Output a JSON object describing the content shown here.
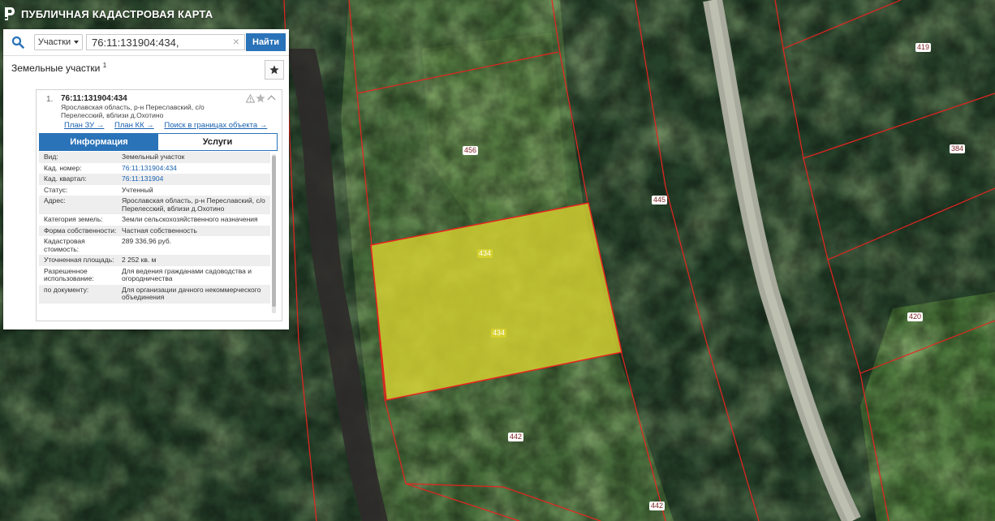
{
  "header": {
    "title": "ПУБЛИЧНАЯ КАДАСТРОВАЯ КАРТА"
  },
  "search": {
    "scope": "Участки",
    "value": "76:11:131904:434,",
    "button": "Найти",
    "clear_glyph": "×"
  },
  "results": {
    "title": "Земельные участки",
    "count": "1",
    "item": {
      "index": "1.",
      "id": "76:11:131904:434",
      "address": "Ярославская область, р-н Переславский, с/о Перелесский, вблизи д.Охотино",
      "links": [
        "План ЗУ →",
        "План КК →",
        "Поиск в границах объекта →"
      ]
    },
    "tabs": [
      "Информация",
      "Услуги"
    ],
    "properties": [
      {
        "label": "Вид:",
        "value": "Земельный участок"
      },
      {
        "label": "Кад. номер:",
        "value": "76:11:131904:434"
      },
      {
        "label": "Кад. квартал:",
        "value": "76:11:131904"
      },
      {
        "label": "Статус:",
        "value": "Учтенный"
      },
      {
        "label": "Адрес:",
        "value": "Ярославская область, р-н Переславский, с/о Перелесский, вблизи д.Охотино"
      },
      {
        "label": "Категория земель:",
        "value": "Земли сельскохозяйственного назначения"
      },
      {
        "label": "Форма собственности:",
        "value": "Частная собственность"
      },
      {
        "label": "Кадастровая стоимость:",
        "value": "289 336,96 руб."
      },
      {
        "label": "Уточненная площадь:",
        "value": "2 252 кв. м"
      },
      {
        "label": "Разрешенное использование:",
        "value": "Для ведения гражданами садоводства и огородничества"
      },
      {
        "label": "по документу:",
        "value": "Для организации дачного некоммерческого объединения"
      }
    ]
  },
  "map": {
    "labels": [
      "419",
      "456",
      "384",
      "445",
      "434",
      "434",
      "420",
      "442",
      "442"
    ],
    "colors": {
      "boundary": "#e8241f",
      "selected_fill": "#d6d130",
      "accent": "#2a73b8"
    }
  }
}
